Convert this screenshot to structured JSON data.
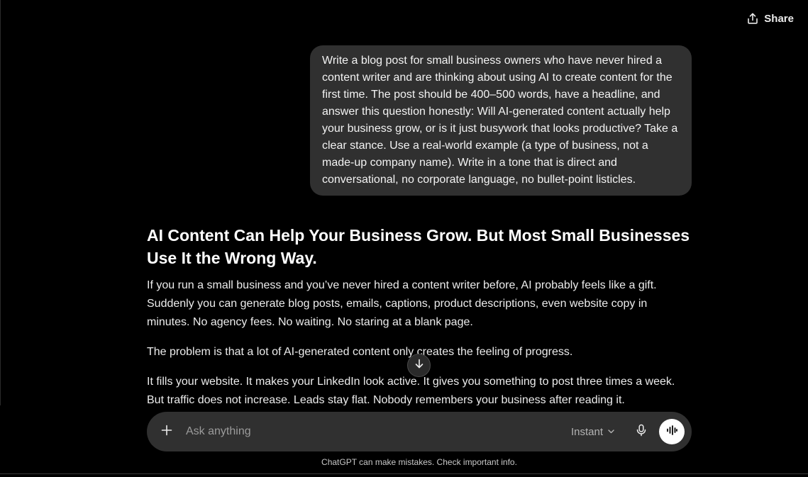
{
  "header": {
    "share_label": "Share",
    "share_icon": "share-upload-icon"
  },
  "conversation": {
    "user_message": "Write a blog post for small business owners who have never hired a content writer and are thinking about using AI to create content for the first time. The post should be 400–500 words, have a headline, and answer this question honestly: Will AI-generated content actually help your business grow, or is it just busywork that looks productive? Take a clear stance. Use a real-world example (a type of business, not a made-up company name). Write in a tone that is direct and conversational, no corporate language, no bullet-point listicles.",
    "assistant": {
      "headline": "AI Content Can Help Your Business Grow. But Most Small Businesses Use It the Wrong Way.",
      "paragraphs": [
        "If you run a small business and you’ve never hired a content writer before, AI probably feels like a gift. Suddenly you can generate blog posts, emails, captions, product descriptions, even website copy in minutes. No agency fees. No waiting. No staring at a blank page.",
        "The problem is that a lot of AI-generated content only creates the feeling of progress.",
        "It fills your website. It makes your LinkedIn look active. It gives you something to post three times a week. But traffic does not increase. Leads stay flat. Nobody remembers your business after reading it."
      ]
    }
  },
  "composer": {
    "placeholder": "Ask anything",
    "value": "",
    "mode_label": "Instant",
    "icons": {
      "add": "plus-icon",
      "mode": "chevron-down-icon",
      "mic": "microphone-icon",
      "voice": "voice-waveform-icon",
      "scroll": "arrow-down-icon"
    }
  },
  "footer": {
    "disclaimer": "ChatGPT can make mistakes. Check important info."
  },
  "colors": {
    "background": "#000000",
    "user_bubble": "#303030",
    "composer": "#303030",
    "text": "#ececec",
    "voice_button": "#ffffff"
  }
}
